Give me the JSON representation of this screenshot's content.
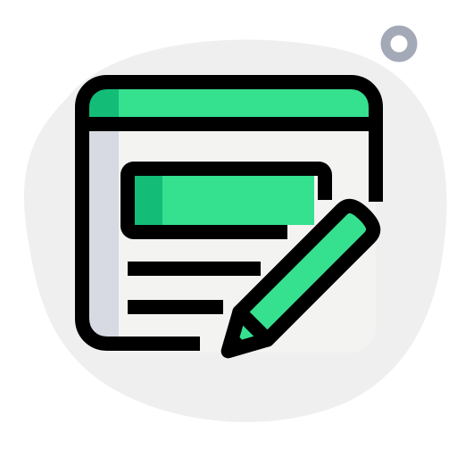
{
  "icon": {
    "name": "edit-web-form-icon",
    "colors": {
      "blob": "#efefef",
      "ring": "#a4a9b8",
      "window_fill": "#f3f3f1",
      "side_shade": "#d7dae3",
      "accent": "#35e08f",
      "accent_dark": "#13bd78",
      "outline": "#000000",
      "background": "#ffffff"
    }
  }
}
